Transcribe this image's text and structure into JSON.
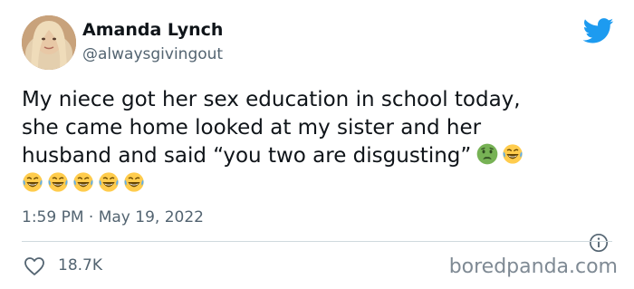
{
  "author": {
    "name": "Amanda Lynch",
    "handle": "@alwaysgivingout"
  },
  "tweet": {
    "line1": "My niece got her sex education in school today,",
    "line2": "she came home looked at my sister and her",
    "line3": "husband and said “you two are disgusting”",
    "emoji_names": [
      "nauseated-face-icon",
      "rolling-laughing-icon",
      "rolling-laughing-icon",
      "rolling-laughing-icon",
      "rolling-laughing-icon",
      "rolling-laughing-icon",
      "rolling-laughing-icon"
    ]
  },
  "meta": {
    "timestamp": "1:59 PM · May 19, 2022",
    "likes": "18.7K"
  },
  "watermark": "boredpanda.com",
  "colors": {
    "twitter_blue": "#1d9bf0",
    "secondary_text": "#536471",
    "divider": "#cfd9de"
  }
}
